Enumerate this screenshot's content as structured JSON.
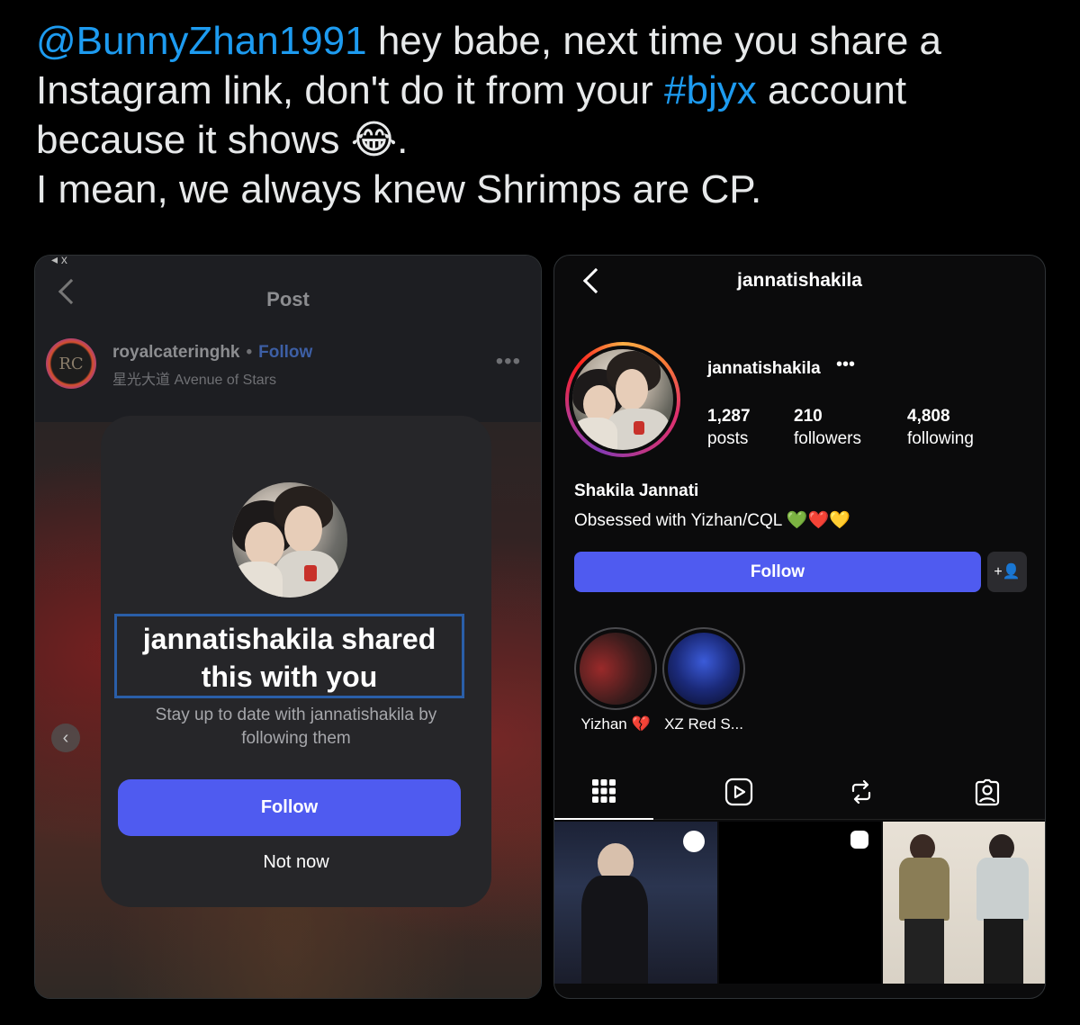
{
  "tweet": {
    "mention": "@BunnyZhan1991",
    "line1_rest": " hey babe, next time you share a",
    "line2_start": "Instagram link, don't do it from your ",
    "hashtag": "#bjyx",
    "line2_end": " account",
    "line3": "because it shows ",
    "emoji": "😂",
    "line3_end": ".",
    "line4": "I mean, we always knew Shrimps are CP."
  },
  "left_screenshot": {
    "status": "◂ x",
    "header_title": "Post",
    "poster": {
      "avatar_text": "RC",
      "username": "royalcateringhk",
      "separator": "•",
      "follow_label": "Follow",
      "location": "星光大道 Avenue of Stars",
      "more": "•••"
    },
    "modal": {
      "title": "jannatishakila shared this with you",
      "subtitle": "Stay up to date with jannatishakila by following them",
      "follow_label": "Follow",
      "not_now_label": "Not now"
    }
  },
  "right_screenshot": {
    "header_title": "jannatishakila",
    "profile": {
      "username": "jannatishakila",
      "more": "•••",
      "posts_count": "1,287",
      "posts_label": "posts",
      "followers_count": "210",
      "followers_label": "followers",
      "following_count": "4,808",
      "following_label": "following",
      "name": "Shakila Jannati",
      "bio": "Obsessed with Yizhan/CQL 💚❤️💛",
      "follow_label": "Follow",
      "add_user_icon": "+👤"
    },
    "highlights": [
      {
        "label": "Yizhan 💔"
      },
      {
        "label": "XZ Red S..."
      }
    ],
    "tabs": [
      {
        "icon": "grid-icon"
      },
      {
        "icon": "reels-icon"
      },
      {
        "icon": "reposts-icon"
      },
      {
        "icon": "tagged-icon"
      }
    ]
  },
  "colors": {
    "link_blue": "#1d9bf0",
    "follow_button": "#4f5bf0",
    "modal_bg": "#262629"
  }
}
